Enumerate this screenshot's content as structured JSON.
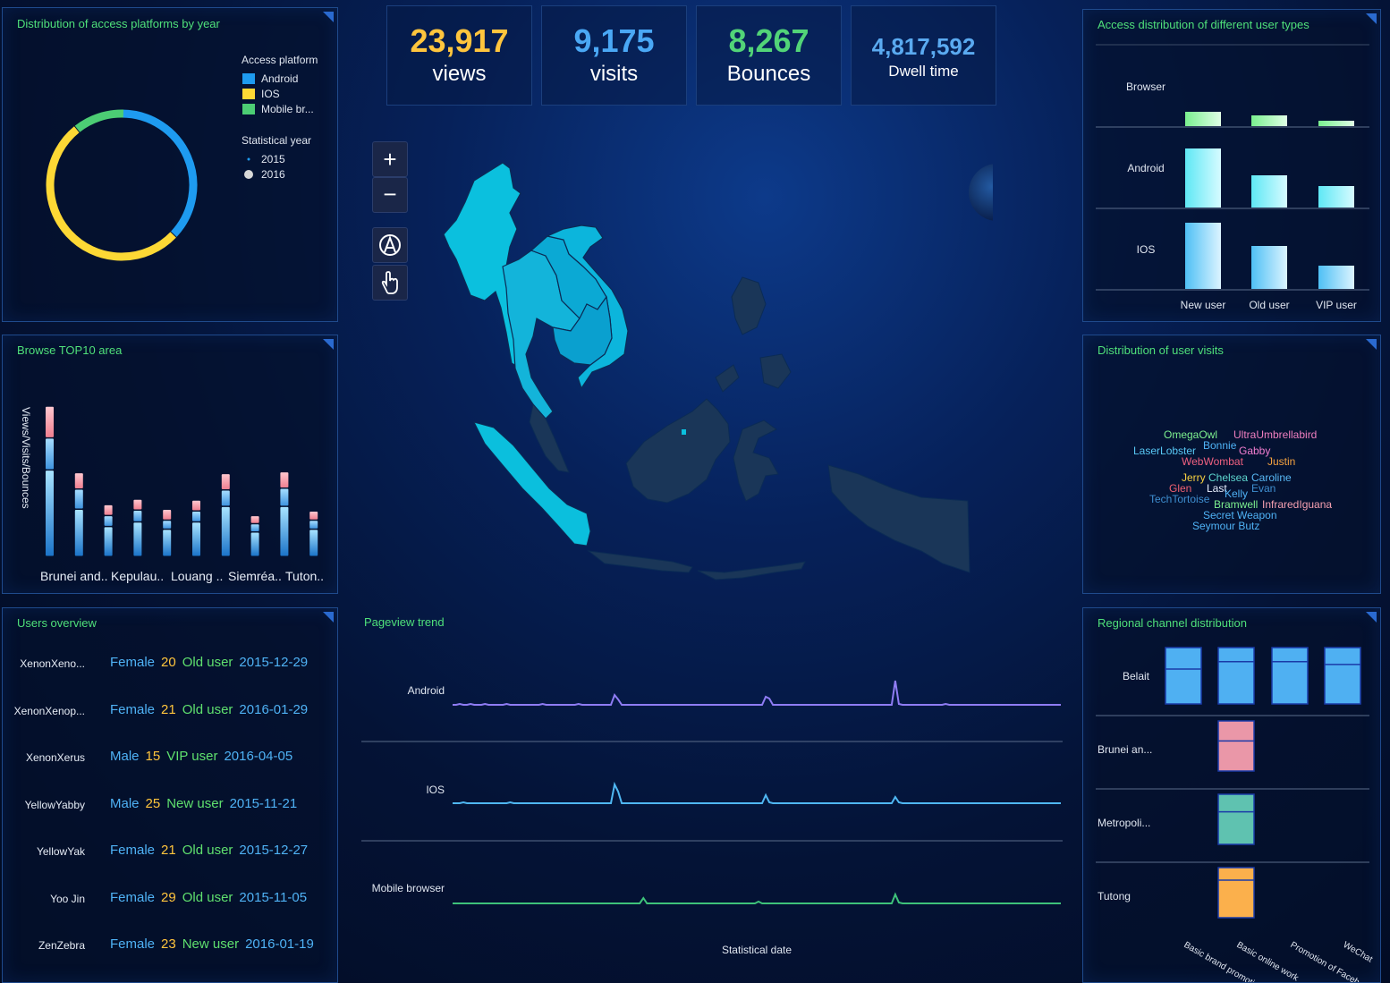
{
  "kpis": [
    {
      "value": "23,917",
      "label": "views",
      "color": "#ffc53d"
    },
    {
      "value": "9,175",
      "label": "visits",
      "color": "#4aa8f5"
    },
    {
      "value": "8,267",
      "label": "Bounces",
      "color": "#52d478"
    },
    {
      "value": "4,817,592",
      "label": "Dwell time",
      "color": "#5aaaf0"
    }
  ],
  "panels": {
    "platform_title": "Distribution of access platforms by year",
    "top10_title": "Browse TOP10 area",
    "users_title": "Users overview",
    "usertype_title": "Access distribution of different user types",
    "visits_title": "Distribution of user visits",
    "regional_title": "Regional channel distribution",
    "trend_title": "Pageview trend"
  },
  "map_controls": {
    "zoom_in": "+",
    "zoom_out": "−"
  },
  "colors": {
    "android": "#1e9bf0",
    "ios": "#fdd835",
    "mobile": "#4ccd74",
    "accent_green": "#4fe07a"
  },
  "chart_data": [
    {
      "id": "platform_donut",
      "type": "pie",
      "legend_platform_title": "Access platform",
      "legend_year_title": "Statistical year",
      "categories": [
        "Android",
        "IOS",
        "Mobile br..."
      ],
      "values": [
        37,
        52,
        11
      ],
      "years": [
        "2015",
        "2016"
      ],
      "legend": "right"
    },
    {
      "id": "top10",
      "type": "bar",
      "ylabel": "Views/Visits/Bounces",
      "tick_labels": [
        "Brunei and..",
        "Kepulau..",
        "Louang ..",
        "Siemréa..",
        "Tuton.."
      ],
      "series": [
        {
          "values": [
            95,
            52,
            33,
            38,
            30,
            38,
            55,
            27,
            55,
            30
          ]
        },
        {
          "values": [
            35,
            22,
            12,
            13,
            10,
            12,
            18,
            9,
            20,
            10
          ]
        },
        {
          "values": [
            35,
            18,
            12,
            12,
            12,
            12,
            18,
            9,
            18,
            10
          ]
        }
      ]
    },
    {
      "id": "usertype",
      "type": "bar",
      "x_categories": [
        "New user",
        "Old user",
        "VIP user"
      ],
      "rows": [
        {
          "name": "Browser",
          "values": [
            16,
            12,
            6
          ]
        },
        {
          "name": "Android",
          "values": [
            66,
            36,
            24
          ]
        },
        {
          "name": "IOS",
          "values": [
            74,
            48,
            26
          ]
        }
      ]
    },
    {
      "id": "regional",
      "type": "bar",
      "x_categories": [
        "Basic brand promotion",
        "Basic online work",
        "Promotion of Facebook",
        "WeChat"
      ],
      "rows": [
        {
          "name": "Belait",
          "color": "#4fb0f2",
          "values": [
            [
              0.62,
              0.38
            ],
            [
              0.75,
              0.25
            ],
            [
              0.75,
              0.25
            ],
            [
              0.7,
              0.3
            ]
          ]
        },
        {
          "name": "Brunei an...",
          "color": "#ea97a8",
          "values": [
            null,
            [
              0.6,
              0.4
            ],
            null,
            null
          ]
        },
        {
          "name": "Metropoli...",
          "color": "#5fc2b0",
          "values": [
            null,
            [
              0.65,
              0.35
            ],
            null,
            null
          ]
        },
        {
          "name": "Tutong",
          "color": "#fbb04c",
          "values": [
            null,
            [
              0.75,
              0.25
            ],
            null,
            null
          ]
        }
      ]
    },
    {
      "id": "trend",
      "type": "line",
      "xlabel": "Statistical date",
      "series": [
        {
          "name": "Android",
          "color": "#8f7cf4",
          "values": [
            3,
            3,
            4,
            3,
            3,
            4,
            3,
            3,
            3,
            4,
            3,
            3,
            3,
            3,
            3,
            4,
            3,
            3,
            3,
            3,
            3,
            3,
            3,
            3,
            3,
            4,
            3,
            3,
            3,
            3,
            3,
            3,
            3,
            3,
            3,
            4,
            3,
            3,
            3,
            3,
            3,
            3,
            3,
            3,
            3,
            14,
            9,
            3,
            3,
            3,
            3,
            3,
            3,
            3,
            3,
            3,
            3,
            3,
            3,
            3,
            3,
            3,
            3,
            3,
            3,
            3,
            3,
            3,
            3,
            3,
            3,
            3,
            3,
            3,
            3,
            3,
            3,
            3,
            3,
            3,
            3,
            3,
            3,
            3,
            3,
            3,
            3,
            12,
            10,
            3,
            3,
            3,
            3,
            3,
            3,
            3,
            3,
            3,
            3,
            3,
            3,
            3,
            3,
            3,
            3,
            3,
            3,
            3,
            3,
            3,
            3,
            3,
            3,
            3,
            3,
            3,
            3,
            3,
            3,
            3,
            3,
            3,
            3,
            30,
            4,
            3,
            3,
            3,
            3,
            3,
            3,
            3,
            3,
            3,
            3,
            3,
            3,
            4,
            3,
            3,
            3,
            3,
            3,
            3,
            3,
            3,
            3,
            3,
            3,
            3,
            3,
            3,
            3,
            3,
            3,
            3,
            3,
            3,
            3,
            3,
            3,
            3,
            3,
            3,
            3,
            3,
            3,
            3,
            3,
            3
          ]
        },
        {
          "name": "IOS",
          "color": "#4fb7f2",
          "values": [
            3,
            3,
            3,
            4,
            3,
            3,
            3,
            3,
            3,
            3,
            3,
            3,
            3,
            3,
            3,
            3,
            4,
            3,
            3,
            3,
            3,
            3,
            3,
            3,
            3,
            3,
            3,
            3,
            3,
            3,
            3,
            3,
            3,
            3,
            3,
            3,
            3,
            3,
            3,
            3,
            3,
            3,
            3,
            3,
            3,
            24,
            16,
            3,
            3,
            3,
            3,
            3,
            3,
            3,
            3,
            3,
            3,
            3,
            3,
            3,
            3,
            3,
            3,
            3,
            3,
            3,
            3,
            3,
            3,
            3,
            3,
            3,
            3,
            3,
            3,
            3,
            3,
            3,
            3,
            3,
            3,
            3,
            3,
            3,
            3,
            3,
            3,
            12,
            4,
            3,
            3,
            3,
            3,
            3,
            3,
            3,
            3,
            3,
            3,
            3,
            3,
            3,
            3,
            3,
            3,
            3,
            3,
            3,
            3,
            3,
            3,
            3,
            3,
            3,
            3,
            3,
            3,
            3,
            3,
            3,
            3,
            3,
            3,
            10,
            4,
            3,
            3,
            3,
            3,
            3,
            3,
            3,
            3,
            3,
            3,
            3,
            3,
            3,
            3,
            3,
            3,
            3,
            3,
            3,
            3,
            3,
            3,
            3,
            3,
            3,
            3,
            3,
            3,
            3,
            3,
            3,
            3,
            3,
            3,
            3,
            3,
            3,
            3,
            3,
            3,
            3,
            3,
            3,
            3,
            3
          ]
        },
        {
          "name": "Mobile browser",
          "color": "#3ec27a",
          "values": [
            2,
            2,
            2,
            2,
            2,
            2,
            2,
            2,
            2,
            2,
            2,
            2,
            2,
            2,
            2,
            2,
            2,
            2,
            2,
            2,
            2,
            2,
            2,
            2,
            2,
            2,
            2,
            2,
            2,
            2,
            2,
            2,
            2,
            2,
            2,
            2,
            2,
            2,
            2,
            2,
            2,
            2,
            2,
            2,
            2,
            2,
            2,
            2,
            2,
            2,
            2,
            2,
            2,
            8,
            2,
            2,
            2,
            2,
            2,
            2,
            2,
            2,
            2,
            2,
            2,
            2,
            2,
            2,
            2,
            2,
            2,
            2,
            2,
            2,
            2,
            2,
            2,
            2,
            2,
            2,
            2,
            2,
            2,
            2,
            2,
            4,
            2,
            2,
            2,
            2,
            2,
            2,
            2,
            2,
            2,
            2,
            2,
            2,
            2,
            2,
            2,
            2,
            2,
            2,
            2,
            2,
            2,
            2,
            2,
            2,
            2,
            2,
            2,
            2,
            2,
            2,
            2,
            2,
            2,
            2,
            2,
            2,
            2,
            12,
            3,
            2,
            2,
            2,
            2,
            2,
            2,
            2,
            2,
            2,
            2,
            2,
            2,
            2,
            2,
            2,
            2,
            2,
            2,
            2,
            2,
            2,
            2,
            2,
            2,
            2,
            2,
            2,
            2,
            2,
            2,
            2,
            2,
            2,
            2,
            2,
            2,
            2,
            2,
            2,
            2,
            2,
            2,
            2,
            2,
            2
          ]
        }
      ]
    }
  ],
  "users": [
    {
      "name": "XenonXeno...",
      "gender": "Female",
      "age": "20",
      "type": "Old user",
      "date": "2015-12-29"
    },
    {
      "name": "XenonXenop...",
      "gender": "Female",
      "age": "21",
      "type": "Old user",
      "date": "2016-01-29"
    },
    {
      "name": "XenonXerus",
      "gender": "Male",
      "age": "15",
      "type": "VIP user",
      "date": "2016-04-05"
    },
    {
      "name": "YellowYabby",
      "gender": "Male",
      "age": "25",
      "type": "New user",
      "date": "2015-11-21"
    },
    {
      "name": "YellowYak",
      "gender": "Female",
      "age": "21",
      "type": "Old user",
      "date": "2015-12-27"
    },
    {
      "name": "Yoo Jin",
      "gender": "Female",
      "age": "29",
      "type": "Old user",
      "date": "2015-11-05"
    },
    {
      "name": "ZenZebra",
      "gender": "Female",
      "age": "23",
      "type": "New user",
      "date": "2016-01-19"
    }
  ],
  "wordcloud": [
    {
      "text": "OmegaOwl",
      "color": "#7df08f"
    },
    {
      "text": "UltraUmbrellabird",
      "color": "#f07fc0"
    },
    {
      "text": "LaserLobster",
      "color": "#58c8f5"
    },
    {
      "text": "Bonnie",
      "color": "#4fb2f5"
    },
    {
      "text": "Gabby",
      "color": "#f27dd0"
    },
    {
      "text": "WebWombat",
      "color": "#f06080"
    },
    {
      "text": "Justin",
      "color": "#f5a340"
    },
    {
      "text": "Jerry",
      "color": "#f5d040"
    },
    {
      "text": "Chelsea",
      "color": "#5fd8d0"
    },
    {
      "text": "Caroline",
      "color": "#58b8f5"
    },
    {
      "text": "Glen",
      "color": "#f06070"
    },
    {
      "text": "Last",
      "color": "#e8f0ff"
    },
    {
      "text": "Kelly",
      "color": "#4fb2f5"
    },
    {
      "text": "Evan",
      "color": "#3f8fd0"
    },
    {
      "text": "TechTortoise",
      "color": "#3e8ed0"
    },
    {
      "text": "Bramwell",
      "color": "#7df08f"
    },
    {
      "text": "InfraredIguana",
      "color": "#f5a0b0"
    },
    {
      "text": "Secret Weapon",
      "color": "#4fb2f5"
    },
    {
      "text": "Seymour Butz",
      "color": "#4fb2f5"
    }
  ]
}
